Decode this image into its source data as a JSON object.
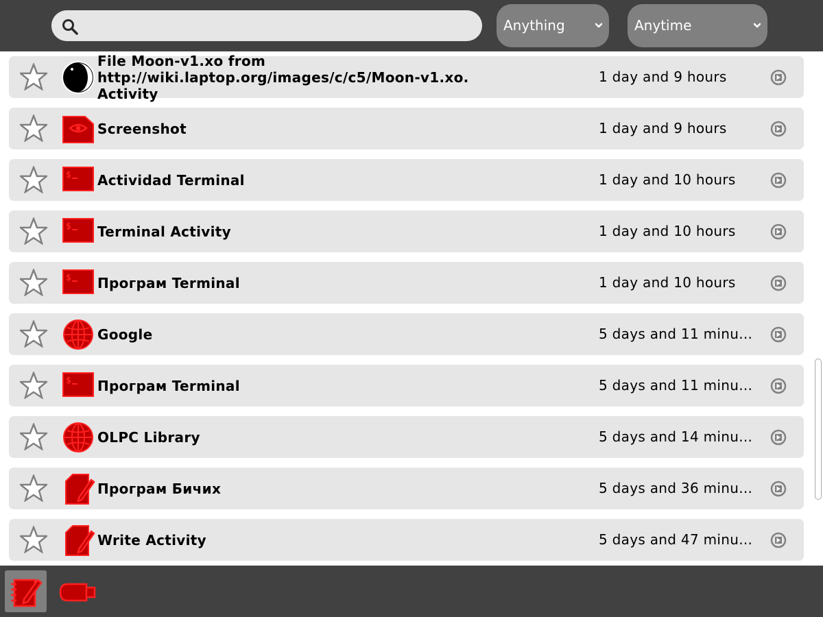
{
  "toolbar": {
    "search": {
      "icon": "search-icon",
      "value": "",
      "placeholder": ""
    },
    "filter_what": {
      "selected": "Anything",
      "icon": "chevron-down-icon"
    },
    "filter_when": {
      "selected": "Anytime",
      "icon": "chevron-down-icon"
    }
  },
  "entries": [
    {
      "title": "File Moon-v1.xo from http://wiki.laptop.org/images/c/c5/Moon-v1.xo. Activity",
      "date": "1 day and 9 hours",
      "icon": "moon-icon",
      "starred": false
    },
    {
      "title": "Screenshot",
      "date": "1 day and 9 hours",
      "icon": "image-icon",
      "starred": false
    },
    {
      "title": "Actividad Terminal",
      "date": "1 day and 10 hours",
      "icon": "terminal-icon",
      "starred": false
    },
    {
      "title": "Terminal Activity",
      "date": "1 day and 10 hours",
      "icon": "terminal-icon",
      "starred": false
    },
    {
      "title": "Програм Terminal",
      "date": "1 day and 10 hours",
      "icon": "terminal-icon",
      "starred": false
    },
    {
      "title": "Google",
      "date": "5 days and 11 minu...",
      "icon": "globe-icon",
      "starred": false
    },
    {
      "title": "Програм Terminal",
      "date": "5 days and 11 minu...",
      "icon": "terminal-icon",
      "starred": false
    },
    {
      "title": "OLPC Library",
      "date": "5 days and 14 minu...",
      "icon": "globe-icon",
      "starred": false
    },
    {
      "title": "Програм Бичих",
      "date": "5 days and 36 minu...",
      "icon": "write-icon",
      "starred": false
    },
    {
      "title": "Write Activity",
      "date": "5 days and 47 minu...",
      "icon": "write-icon",
      "starred": false
    }
  ],
  "bottombar": {
    "journal_button": {
      "icon": "journal-icon",
      "selected": true
    },
    "device_button": {
      "icon": "usb-drive-icon",
      "selected": false
    }
  },
  "colors": {
    "toolbar_bg": "#414141",
    "row_bg": "#e6e6e6",
    "icon_fill": "#c00000",
    "icon_stroke": "#ff2020",
    "combo_bg": "#808080"
  }
}
